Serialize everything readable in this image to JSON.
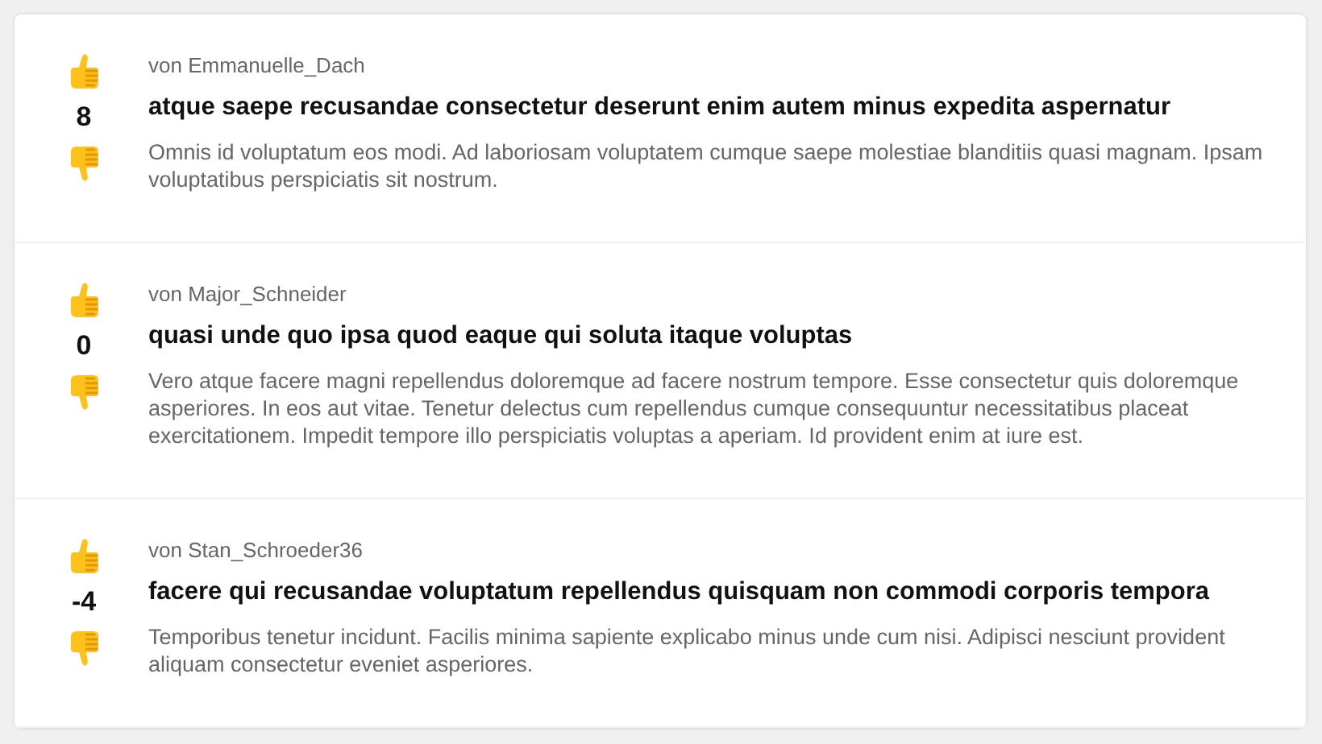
{
  "posts": [
    {
      "score": "8",
      "author": "von Emmanuelle_Dach",
      "title": "atque saepe recusandae consectetur deserunt enim autem minus expedita aspernatur",
      "body": "Omnis id voluptatum eos modi. Ad laboriosam voluptatem cumque saepe molestiae blanditiis quasi magnam. Ipsam voluptatibus perspiciatis sit nostrum."
    },
    {
      "score": "0",
      "author": "von Major_Schneider",
      "title": "quasi unde quo ipsa quod eaque qui soluta itaque voluptas",
      "body": "Vero atque facere magni repellendus doloremque ad facere nostrum tempore. Esse consectetur quis doloremque asperiores. In eos aut vitae. Tenetur delectus cum repellendus cumque consequuntur necessitatibus placeat exercitationem. Impedit tempore illo perspiciatis voluptas a aperiam. Id provident enim at iure est."
    },
    {
      "score": "-4",
      "author": "von Stan_Schroeder36",
      "title": "facere qui recusandae voluptatum repellendus quisquam non commodi corporis tempora",
      "body": "Temporibus tenetur incidunt. Facilis minima sapiente explicabo minus unde cum nisi. Adipisci nesciunt provident aliquam consectetur eveniet asperiores."
    }
  ]
}
